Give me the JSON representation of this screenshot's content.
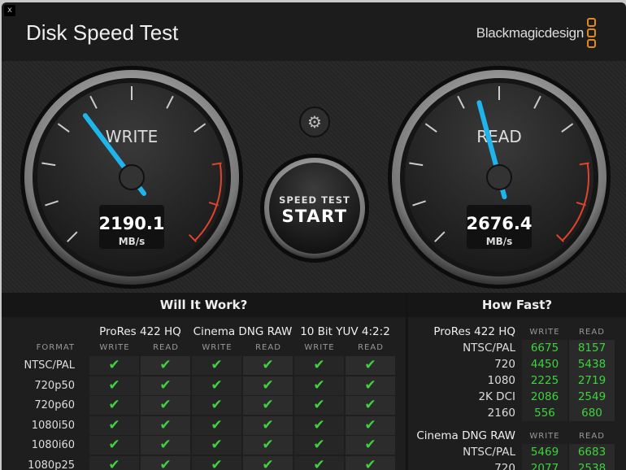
{
  "window": {
    "close_label": "x",
    "title": "Disk Speed Test",
    "brand": "Blackmagicdesign"
  },
  "gauges": {
    "write": {
      "label": "WRITE",
      "value": "2190.1",
      "unit": "MB/s"
    },
    "read": {
      "label": "READ",
      "value": "2676.4",
      "unit": "MB/s"
    }
  },
  "start_button": {
    "line1": "SPEED TEST",
    "line2": "START"
  },
  "will_it_work": {
    "title": "Will It Work?",
    "format_header": "FORMAT",
    "groups": [
      "ProRes 422 HQ",
      "Cinema DNG RAW",
      "10 Bit YUV 4:2:2"
    ],
    "sub": [
      "WRITE",
      "READ"
    ],
    "check": "✔",
    "rows": [
      "NTSC/PAL",
      "720p50",
      "720p60",
      "1080i50",
      "1080i60",
      "1080p25"
    ]
  },
  "how_fast": {
    "title": "How Fast?",
    "sections": [
      {
        "name": "ProRes 422 HQ",
        "write": "WRITE",
        "read": "READ",
        "rows": [
          {
            "f": "NTSC/PAL",
            "w": "6675",
            "r": "8157"
          },
          {
            "f": "720",
            "w": "4450",
            "r": "5438"
          },
          {
            "f": "1080",
            "w": "2225",
            "r": "2719"
          },
          {
            "f": "2K DCI",
            "w": "2086",
            "r": "2549"
          },
          {
            "f": "2160",
            "w": "556",
            "r": "680"
          }
        ]
      },
      {
        "name": "Cinema DNG RAW",
        "write": "WRITE",
        "read": "READ",
        "rows": [
          {
            "f": "NTSC/PAL",
            "w": "5469",
            "r": "6683"
          },
          {
            "f": "720",
            "w": "2077",
            "r": "2538"
          }
        ]
      }
    ]
  },
  "colors": {
    "accent": "#1fb4ea",
    "check": "#3fd23f",
    "logo": "#e08a1e",
    "redline": "#e0442c"
  }
}
